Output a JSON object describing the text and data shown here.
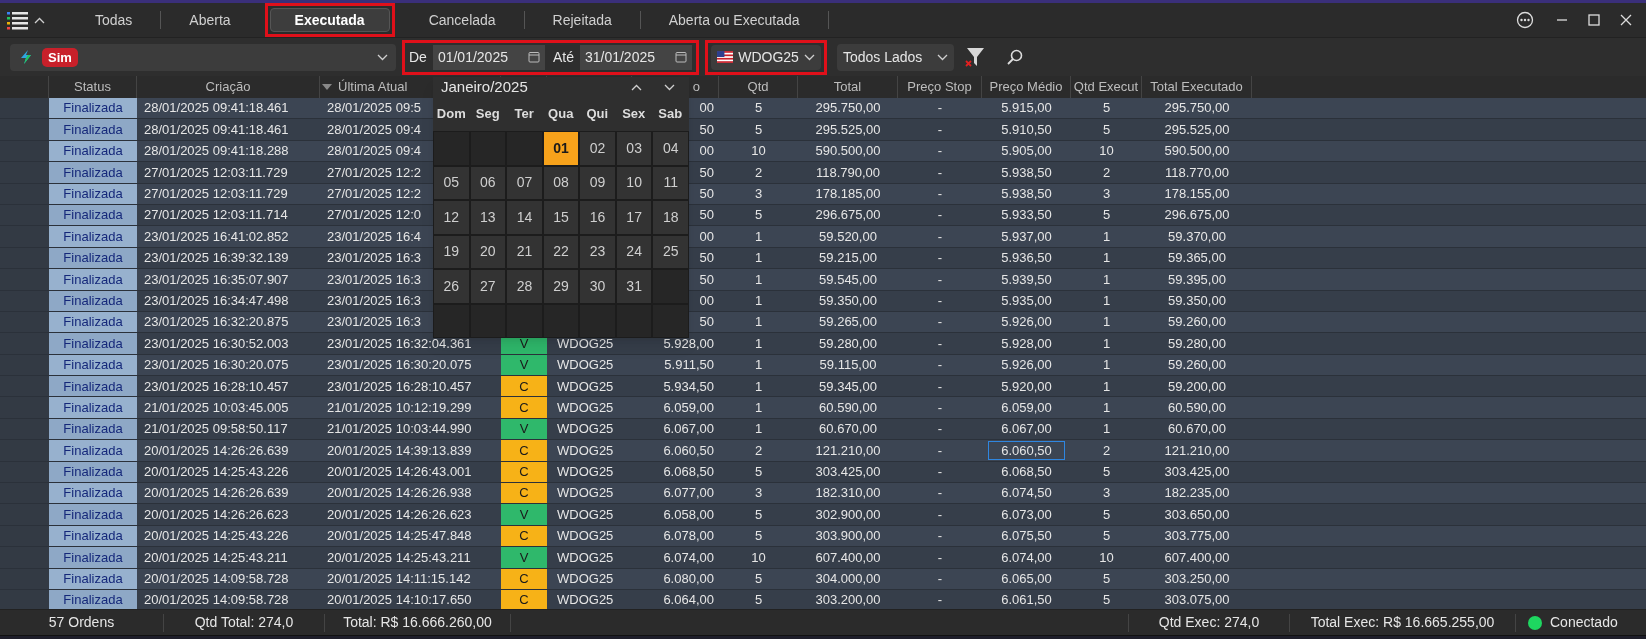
{
  "tabs": [
    {
      "label": "Todas",
      "selected": false
    },
    {
      "label": "Aberta",
      "selected": false
    },
    {
      "label": "Executada",
      "selected": true
    },
    {
      "label": "Cancelada",
      "selected": false
    },
    {
      "label": "Rejeitada",
      "selected": false
    },
    {
      "label": "Aberta ou Executada",
      "selected": false
    }
  ],
  "toolbar": {
    "account_badge": "Sim",
    "from_label": "De",
    "from_date": "01/01/2025",
    "to_label": "Até",
    "to_date": "31/01/2025",
    "symbol": "WDOG25",
    "side_filter": "Todos Lados"
  },
  "table": {
    "columns": [
      "Status",
      "Criação",
      "Última Atual",
      "o",
      "Qtd",
      "Total",
      "Preço Stop",
      "Preço Médio",
      "Qtd Execut",
      "Total Executado"
    ],
    "rows": [
      {
        "status": "Finalizada",
        "created": "28/01/2025 09:41:18.461",
        "updated": "28/01/2025 09:5",
        "price": "00",
        "qty": "5",
        "total": "295.750,00",
        "stop": "-",
        "avg": "5.915,00",
        "qty_exec": "5",
        "total_exec": "295.750,00",
        "focused": false
      },
      {
        "status": "Finalizada",
        "created": "28/01/2025 09:41:18.461",
        "updated": "28/01/2025 09:4",
        "price": "50",
        "qty": "5",
        "total": "295.525,00",
        "stop": "-",
        "avg": "5.910,50",
        "qty_exec": "5",
        "total_exec": "295.525,00",
        "focused": false
      },
      {
        "status": "Finalizada",
        "created": "28/01/2025 09:41:18.288",
        "updated": "28/01/2025 09:4",
        "price": "00",
        "qty": "10",
        "total": "590.500,00",
        "stop": "-",
        "avg": "5.905,00",
        "qty_exec": "10",
        "total_exec": "590.500,00",
        "focused": false
      },
      {
        "status": "Finalizada",
        "created": "27/01/2025 12:03:11.729",
        "updated": "27/01/2025 12:2",
        "price": "50",
        "qty": "2",
        "total": "118.790,00",
        "stop": "-",
        "avg": "5.938,50",
        "qty_exec": "2",
        "total_exec": "118.770,00",
        "focused": false
      },
      {
        "status": "Finalizada",
        "created": "27/01/2025 12:03:11.729",
        "updated": "27/01/2025 12:2",
        "price": "50",
        "qty": "3",
        "total": "178.185,00",
        "stop": "-",
        "avg": "5.938,50",
        "qty_exec": "3",
        "total_exec": "178.155,00",
        "focused": false
      },
      {
        "status": "Finalizada",
        "created": "27/01/2025 12:03:11.714",
        "updated": "27/01/2025 12:0",
        "price": "50",
        "qty": "5",
        "total": "296.675,00",
        "stop": "-",
        "avg": "5.933,50",
        "qty_exec": "5",
        "total_exec": "296.675,00",
        "focused": false
      },
      {
        "status": "Finalizada",
        "created": "23/01/2025 16:41:02.852",
        "updated": "23/01/2025 16:4",
        "price": "00",
        "qty": "1",
        "total": "59.520,00",
        "stop": "-",
        "avg": "5.937,00",
        "qty_exec": "1",
        "total_exec": "59.370,00",
        "focused": false
      },
      {
        "status": "Finalizada",
        "created": "23/01/2025 16:39:32.139",
        "updated": "23/01/2025 16:3",
        "price": "50",
        "qty": "1",
        "total": "59.215,00",
        "stop": "-",
        "avg": "5.936,50",
        "qty_exec": "1",
        "total_exec": "59.365,00",
        "focused": false
      },
      {
        "status": "Finalizada",
        "created": "23/01/2025 16:35:07.907",
        "updated": "23/01/2025 16:3",
        "price": "50",
        "qty": "1",
        "total": "59.545,00",
        "stop": "-",
        "avg": "5.939,50",
        "qty_exec": "1",
        "total_exec": "59.395,00",
        "focused": false
      },
      {
        "status": "Finalizada",
        "created": "23/01/2025 16:34:47.498",
        "updated": "23/01/2025 16:3",
        "price": "00",
        "qty": "1",
        "total": "59.350,00",
        "stop": "-",
        "avg": "5.935,00",
        "qty_exec": "1",
        "total_exec": "59.350,00",
        "focused": false
      },
      {
        "status": "Finalizada",
        "created": "23/01/2025 16:32:20.875",
        "updated": "23/01/2025 16:3",
        "price": "50",
        "qty": "1",
        "total": "59.265,00",
        "stop": "-",
        "avg": "5.926,00",
        "qty_exec": "1",
        "total_exec": "59.260,00",
        "focused": false
      },
      {
        "status": "Finalizada",
        "created": "23/01/2025 16:30:52.003",
        "updated": "23/01/2025 16:32:04.361",
        "side": {
          "label": "V",
          "kind": "sell"
        },
        "asset": "WDOG25",
        "price": "5.928,00",
        "qty": "1",
        "total": "59.280,00",
        "stop": "-",
        "avg": "5.928,00",
        "qty_exec": "1",
        "total_exec": "59.280,00",
        "focused": false
      },
      {
        "status": "Finalizada",
        "created": "23/01/2025 16:30:20.075",
        "updated": "23/01/2025 16:30:20.075",
        "side": {
          "label": "V",
          "kind": "sell"
        },
        "asset": "WDOG25",
        "price": "5.911,50",
        "qty": "1",
        "total": "59.115,00",
        "stop": "-",
        "avg": "5.926,00",
        "qty_exec": "1",
        "total_exec": "59.260,00",
        "focused": false
      },
      {
        "status": "Finalizada",
        "created": "23/01/2025 16:28:10.457",
        "updated": "23/01/2025 16:28:10.457",
        "side": {
          "label": "C",
          "kind": "buy"
        },
        "asset": "WDOG25",
        "price": "5.934,50",
        "qty": "1",
        "total": "59.345,00",
        "stop": "-",
        "avg": "5.920,00",
        "qty_exec": "1",
        "total_exec": "59.200,00",
        "focused": false
      },
      {
        "status": "Finalizada",
        "created": "21/01/2025 10:03:45.005",
        "updated": "21/01/2025 10:12:19.299",
        "side": {
          "label": "C",
          "kind": "buy"
        },
        "asset": "WDOG25",
        "price": "6.059,00",
        "qty": "1",
        "total": "60.590,00",
        "stop": "-",
        "avg": "6.059,00",
        "qty_exec": "1",
        "total_exec": "60.590,00",
        "focused": false
      },
      {
        "status": "Finalizada",
        "created": "21/01/2025 09:58:50.117",
        "updated": "21/01/2025 10:03:44.990",
        "side": {
          "label": "V",
          "kind": "sell"
        },
        "asset": "WDOG25",
        "price": "6.067,00",
        "qty": "1",
        "total": "60.670,00",
        "stop": "-",
        "avg": "6.067,00",
        "qty_exec": "1",
        "total_exec": "60.670,00",
        "focused": false
      },
      {
        "status": "Finalizada",
        "created": "20/01/2025 14:26:26.639",
        "updated": "20/01/2025 14:39:13.839",
        "side": {
          "label": "C",
          "kind": "buy"
        },
        "asset": "WDOG25",
        "price": "6.060,50",
        "qty": "2",
        "total": "121.210,00",
        "stop": "-",
        "avg": "6.060,50",
        "qty_exec": "2",
        "total_exec": "121.210,00",
        "focused": true
      },
      {
        "status": "Finalizada",
        "created": "20/01/2025 14:25:43.226",
        "updated": "20/01/2025 14:26:43.001",
        "side": {
          "label": "C",
          "kind": "buy"
        },
        "asset": "WDOG25",
        "price": "6.068,50",
        "qty": "5",
        "total": "303.425,00",
        "stop": "-",
        "avg": "6.068,50",
        "qty_exec": "5",
        "total_exec": "303.425,00",
        "focused": false
      },
      {
        "status": "Finalizada",
        "created": "20/01/2025 14:26:26.639",
        "updated": "20/01/2025 14:26:26.938",
        "side": {
          "label": "C",
          "kind": "buy"
        },
        "asset": "WDOG25",
        "price": "6.077,00",
        "qty": "3",
        "total": "182.310,00",
        "stop": "-",
        "avg": "6.074,50",
        "qty_exec": "3",
        "total_exec": "182.235,00",
        "focused": false
      },
      {
        "status": "Finalizada",
        "created": "20/01/2025 14:26:26.623",
        "updated": "20/01/2025 14:26:26.623",
        "side": {
          "label": "V",
          "kind": "sell"
        },
        "asset": "WDOG25",
        "price": "6.058,00",
        "qty": "5",
        "total": "302.900,00",
        "stop": "-",
        "avg": "6.073,00",
        "qty_exec": "5",
        "total_exec": "303.650,00",
        "focused": false
      },
      {
        "status": "Finalizada",
        "created": "20/01/2025 14:25:43.226",
        "updated": "20/01/2025 14:25:47.848",
        "side": {
          "label": "C",
          "kind": "buy"
        },
        "asset": "WDOG25",
        "price": "6.078,00",
        "qty": "5",
        "total": "303.900,00",
        "stop": "-",
        "avg": "6.075,50",
        "qty_exec": "5",
        "total_exec": "303.775,00",
        "focused": false
      },
      {
        "status": "Finalizada",
        "created": "20/01/2025 14:25:43.211",
        "updated": "20/01/2025 14:25:43.211",
        "side": {
          "label": "V",
          "kind": "sell"
        },
        "asset": "WDOG25",
        "price": "6.074,00",
        "qty": "10",
        "total": "607.400,00",
        "stop": "-",
        "avg": "6.074,00",
        "qty_exec": "10",
        "total_exec": "607.400,00",
        "focused": false
      },
      {
        "status": "Finalizada",
        "created": "20/01/2025 14:09:58.728",
        "updated": "20/01/2025 14:11:15.142",
        "side": {
          "label": "C",
          "kind": "buy"
        },
        "asset": "WDOG25",
        "price": "6.080,00",
        "qty": "5",
        "total": "304.000,00",
        "stop": "-",
        "avg": "6.065,00",
        "qty_exec": "5",
        "total_exec": "303.250,00",
        "focused": false
      },
      {
        "status": "Finalizada",
        "created": "20/01/2025 14:09:58.728",
        "updated": "20/01/2025 14:10:17.650",
        "side": {
          "label": "C",
          "kind": "buy"
        },
        "asset": "WDOG25",
        "price": "6.064,00",
        "qty": "5",
        "total": "303.200,00",
        "stop": "-",
        "avg": "6.061,50",
        "qty_exec": "5",
        "total_exec": "303.075,00",
        "focused": false
      }
    ]
  },
  "calendar": {
    "title": "Janeiro/2025",
    "weekdays": [
      "Dom",
      "Seg",
      "Ter",
      "Qua",
      "Qui",
      "Sex",
      "Sab"
    ],
    "weeks": [
      [
        {
          "kind": "blank"
        },
        {
          "kind": "blank"
        },
        {
          "kind": "blank"
        },
        {
          "kind": "day",
          "day": "01",
          "selected": true
        },
        {
          "kind": "day",
          "day": "02",
          "selected": false
        },
        {
          "kind": "day",
          "day": "03",
          "selected": false
        },
        {
          "kind": "day",
          "day": "04",
          "selected": false
        }
      ],
      [
        {
          "kind": "day",
          "day": "05",
          "selected": false
        },
        {
          "kind": "day",
          "day": "06",
          "selected": false
        },
        {
          "kind": "day",
          "day": "07",
          "selected": false
        },
        {
          "kind": "day",
          "day": "08",
          "selected": false
        },
        {
          "kind": "day",
          "day": "09",
          "selected": false
        },
        {
          "kind": "day",
          "day": "10",
          "selected": false
        },
        {
          "kind": "day",
          "day": "11",
          "selected": false
        }
      ],
      [
        {
          "kind": "day",
          "day": "12",
          "selected": false
        },
        {
          "kind": "day",
          "day": "13",
          "selected": false
        },
        {
          "kind": "day",
          "day": "14",
          "selected": false
        },
        {
          "kind": "day",
          "day": "15",
          "selected": false
        },
        {
          "kind": "day",
          "day": "16",
          "selected": false
        },
        {
          "kind": "day",
          "day": "17",
          "selected": false
        },
        {
          "kind": "day",
          "day": "18",
          "selected": false
        }
      ],
      [
        {
          "kind": "day",
          "day": "19",
          "selected": false
        },
        {
          "kind": "day",
          "day": "20",
          "selected": false
        },
        {
          "kind": "day",
          "day": "21",
          "selected": false
        },
        {
          "kind": "day",
          "day": "22",
          "selected": false
        },
        {
          "kind": "day",
          "day": "23",
          "selected": false
        },
        {
          "kind": "day",
          "day": "24",
          "selected": false
        },
        {
          "kind": "day",
          "day": "25",
          "selected": false
        }
      ],
      [
        {
          "kind": "day",
          "day": "26",
          "selected": false
        },
        {
          "kind": "day",
          "day": "27",
          "selected": false
        },
        {
          "kind": "day",
          "day": "28",
          "selected": false
        },
        {
          "kind": "day",
          "day": "29",
          "selected": false
        },
        {
          "kind": "day",
          "day": "30",
          "selected": false
        },
        {
          "kind": "day",
          "day": "31",
          "selected": false
        },
        {
          "kind": "blank"
        }
      ],
      [
        {
          "kind": "blank"
        },
        {
          "kind": "blank"
        },
        {
          "kind": "blank"
        },
        {
          "kind": "blank"
        },
        {
          "kind": "blank"
        },
        {
          "kind": "blank"
        },
        {
          "kind": "blank"
        }
      ]
    ]
  },
  "status_bar": {
    "orders": "57 Ordens",
    "qty_total": "Qtd Total: 274,0",
    "total": "Total: R$ 16.666.260,00",
    "qty_exec": "Qtd Exec: 274,0",
    "total_exec": "Total Exec: R$ 16.665.255,00",
    "connection": {
      "label": "Conectado",
      "color": "#1ed760"
    }
  }
}
